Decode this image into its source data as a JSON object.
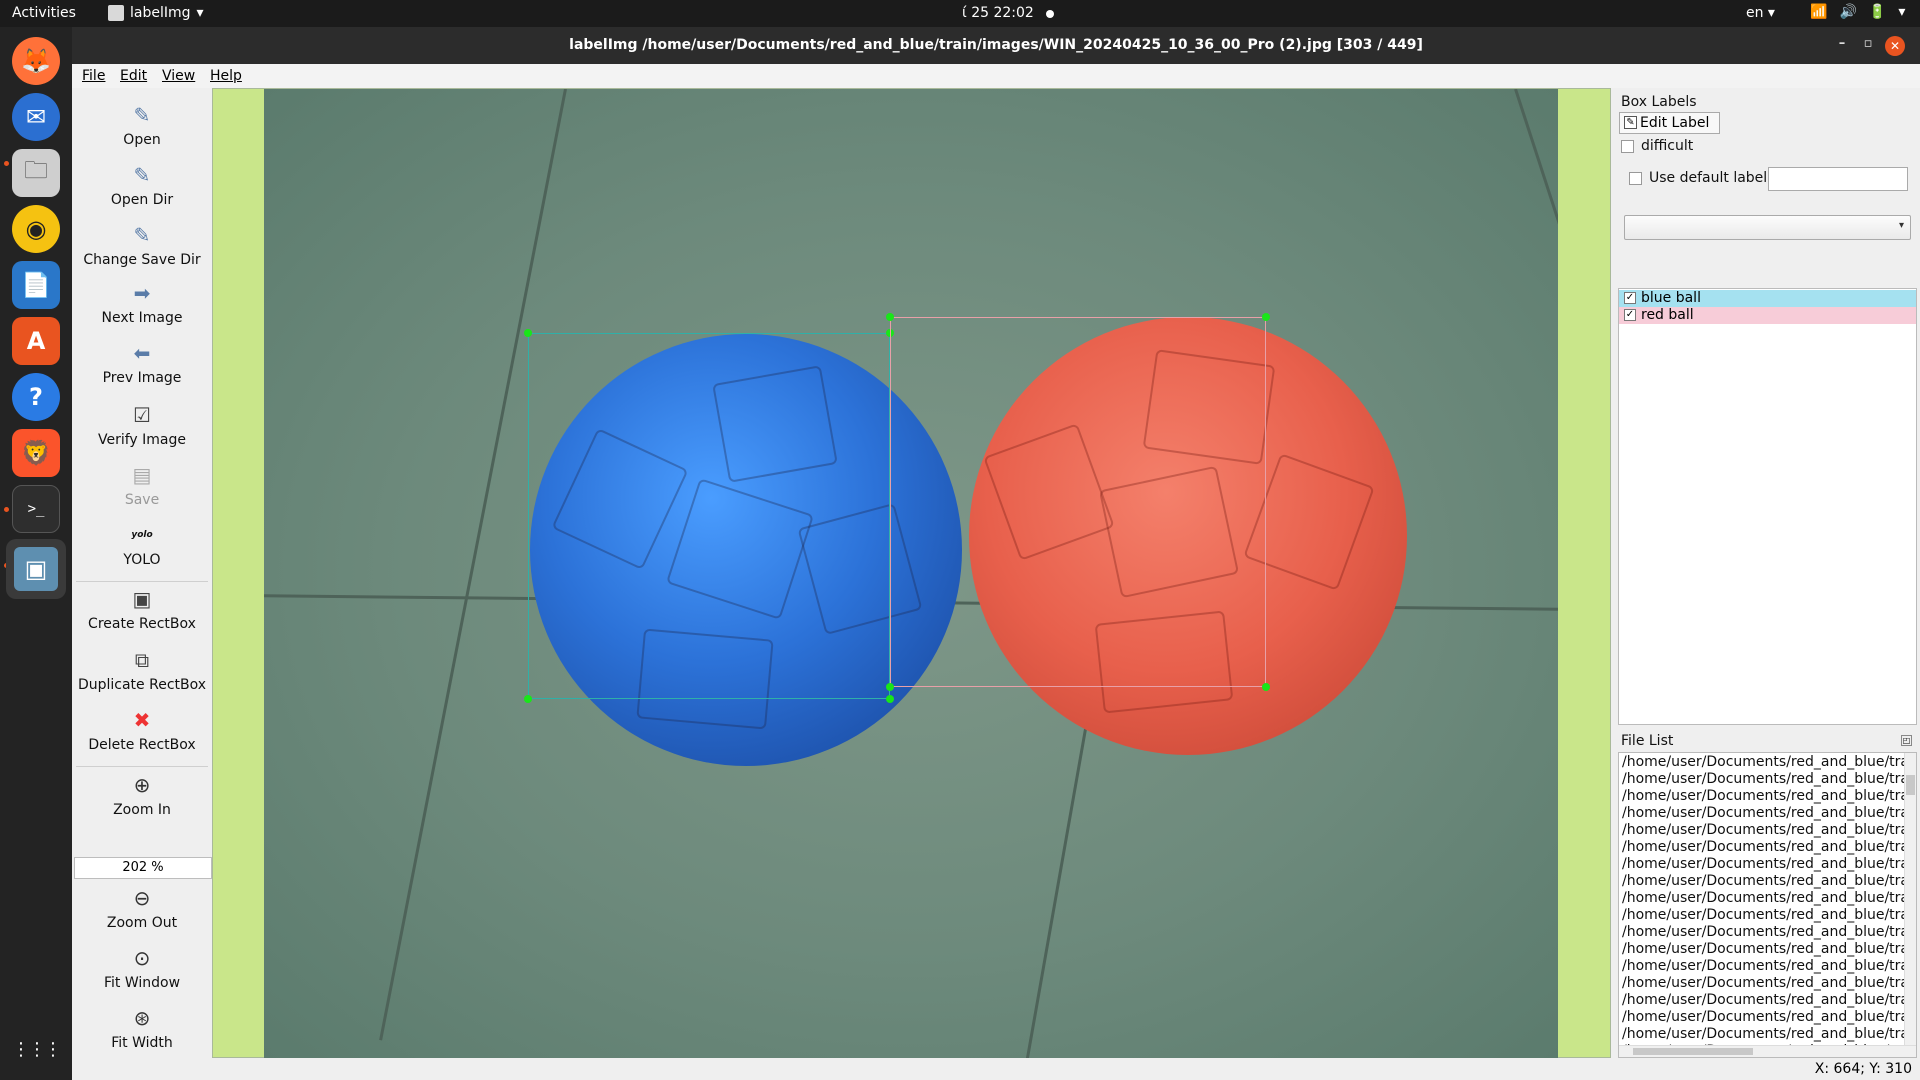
{
  "topbar": {
    "activities": "Activities",
    "app_name": "labelImg",
    "app_dropdown": "▾",
    "clock": "ί 25  22:02",
    "lang": "en ▾",
    "tray": [
      "📶",
      "🔊",
      "🔋",
      "▾"
    ]
  },
  "dock": {
    "apps": [
      {
        "name": "firefox",
        "glyph": "🦊",
        "color": "#e66000"
      },
      {
        "name": "thunderbird",
        "glyph": "✉",
        "color": "#2b6fd1"
      },
      {
        "name": "files",
        "glyph": "🗀",
        "color": "#d4d4d4"
      },
      {
        "name": "rhythmbox",
        "glyph": "◉",
        "color": "#f5c211"
      },
      {
        "name": "writer",
        "glyph": "📄",
        "color": "#2a77c9"
      },
      {
        "name": "software",
        "glyph": "A",
        "color": "#e95420"
      },
      {
        "name": "help",
        "glyph": "?",
        "color": "#2a7be4"
      },
      {
        "name": "brave",
        "glyph": "🦁",
        "color": "#fb542b"
      },
      {
        "name": "terminal",
        "glyph": ">_",
        "color": "#3b3b3b"
      },
      {
        "name": "labelimg",
        "glyph": "▣",
        "color": "#5e8fb0"
      }
    ],
    "grid_glyph": "⋮⋮⋮"
  },
  "window": {
    "title": "labelImg /home/user/Documents/red_and_blue/train/images/WIN_20240425_10_36_00_Pro (2).jpg [303 / 449]",
    "minimize": "–",
    "maximize": "▫",
    "close": "✕"
  },
  "menu": [
    "File",
    "Edit",
    "View",
    "Help"
  ],
  "toolbar": {
    "open": "Open",
    "open_dir": "Open Dir",
    "change_save_dir": "Change Save Dir",
    "next_image": "Next Image",
    "prev_image": "Prev Image",
    "verify_image": "Verify Image",
    "save": "Save",
    "format_icon": "yolo",
    "format": "YOLO",
    "create_rectbox": "Create RectBox",
    "duplicate_rectbox": "Duplicate RectBox",
    "delete_rectbox": "Delete RectBox",
    "zoom_in": "Zoom In",
    "zoom_value": "202 %",
    "zoom_out": "Zoom Out",
    "fit_window": "Fit Window",
    "fit_width": "Fit Width"
  },
  "box_labels": {
    "title": "Box Labels",
    "edit_label": "Edit Label",
    "difficult": "difficult",
    "use_default_label": "Use default label",
    "default_label_value": "",
    "combo_value": "",
    "labels": [
      {
        "name": "blue ball",
        "checked": true,
        "bg": "#a5e1f0"
      },
      {
        "name": "red ball",
        "checked": true,
        "bg": "#f7ccd8"
      }
    ]
  },
  "file_list": {
    "title": "File List",
    "files": [
      "/home/user/Documents/red_and_blue/trai",
      "/home/user/Documents/red_and_blue/trai",
      "/home/user/Documents/red_and_blue/trai",
      "/home/user/Documents/red_and_blue/trai",
      "/home/user/Documents/red_and_blue/trai",
      "/home/user/Documents/red_and_blue/trai",
      "/home/user/Documents/red_and_blue/trai",
      "/home/user/Documents/red_and_blue/trai",
      "/home/user/Documents/red_and_blue/trai",
      "/home/user/Documents/red_and_blue/trai",
      "/home/user/Documents/red_and_blue/trai",
      "/home/user/Documents/red_and_blue/trai",
      "/home/user/Documents/red_and_blue/trai",
      "/home/user/Documents/red_and_blue/trai",
      "/home/user/Documents/red_and_blue/trai",
      "/home/user/Documents/red_and_blue/trai",
      "/home/user/Documents/red_and_blue/trai",
      "/home/user/Documents/red_and_blue/trai"
    ]
  },
  "canvas": {
    "boxes": [
      {
        "label": "blue ball",
        "color": "#2fb0a8"
      },
      {
        "label": "red ball",
        "color": "#e8a0a8"
      }
    ]
  },
  "status": {
    "coords": "X: 664; Y: 310"
  }
}
